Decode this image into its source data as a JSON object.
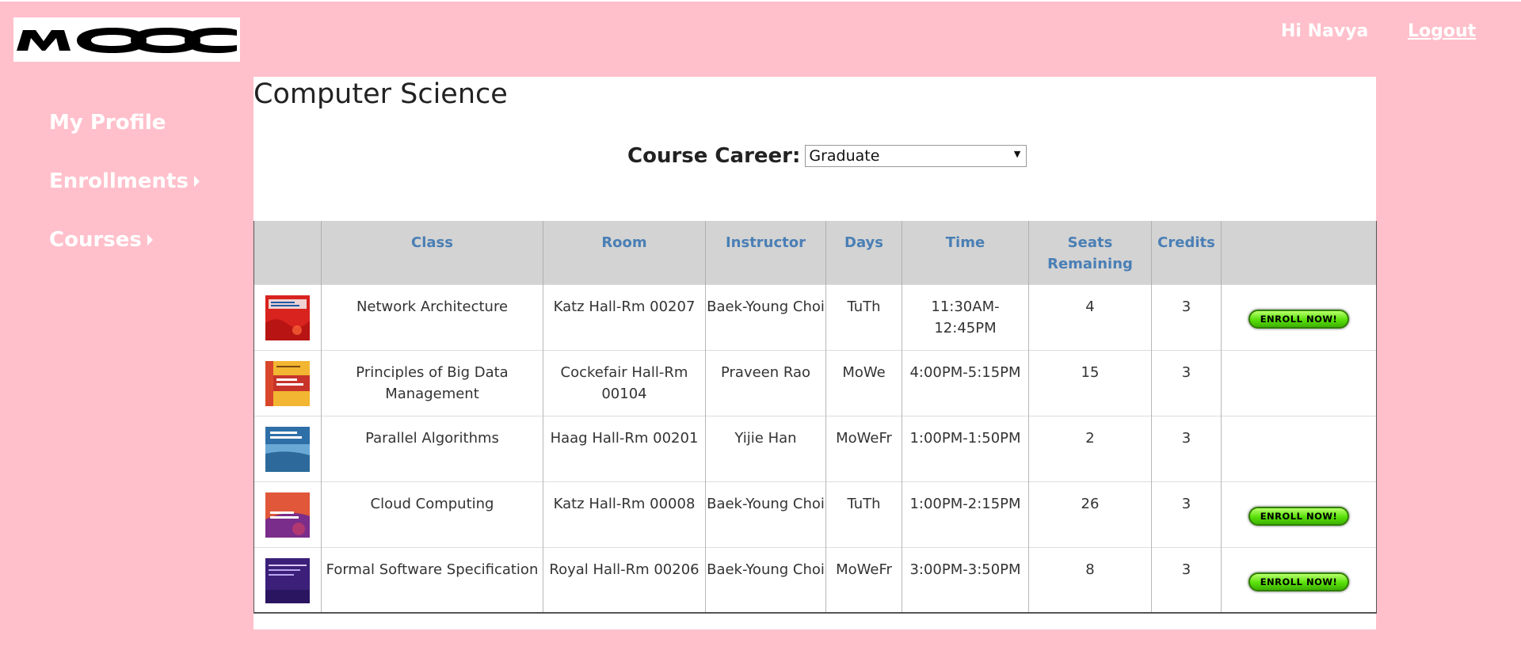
{
  "header": {
    "logo_text": "MOOC",
    "greeting": "Hi Navya",
    "logout_label": "Logout"
  },
  "sidebar": {
    "items": [
      {
        "label": "My Profile",
        "has_submenu": false
      },
      {
        "label": "Enrollments",
        "has_submenu": true
      },
      {
        "label": "Courses",
        "has_submenu": true
      }
    ]
  },
  "main": {
    "title": "Computer Science",
    "career_label": "Course Career:",
    "career_selected": "Graduate"
  },
  "table": {
    "headers": [
      "",
      "Class",
      "Room",
      "Instructor",
      "Days",
      "Time",
      "Seats Remaining",
      "Credits",
      ""
    ],
    "rows": [
      {
        "class": "Network Architecture",
        "room": "Katz Hall-Rm 00207",
        "instructor": "Baek-Young Choi",
        "days": "TuTh",
        "time": "11:30AM-12:45PM",
        "seats": "4",
        "credits": "3",
        "enroll": "ENROLL NOW!",
        "cover": "network-architecture-book-cover-icon"
      },
      {
        "class": "Principles of Big Data Management",
        "room": "Cockefair Hall-Rm 00104",
        "instructor": "Praveen Rao",
        "days": "MoWe",
        "time": "4:00PM-5:15PM",
        "seats": "15",
        "credits": "3",
        "enroll": "",
        "cover": "big-data-book-cover-icon"
      },
      {
        "class": "Parallel Algorithms",
        "room": "Haag Hall-Rm 00201",
        "instructor": "Yijie Han",
        "days": "MoWeFr",
        "time": "1:00PM-1:50PM",
        "seats": "2",
        "credits": "3",
        "enroll": "",
        "cover": "parallel-algorithms-book-cover-icon"
      },
      {
        "class": "Cloud Computing",
        "room": "Katz Hall-Rm 00008",
        "instructor": "Baek-Young Choi",
        "days": "TuTh",
        "time": "1:00PM-2:15PM",
        "seats": "26",
        "credits": "3",
        "enroll": "ENROLL NOW!",
        "cover": "cloud-computing-book-cover-icon"
      },
      {
        "class": "Formal Software Specification",
        "room": "Royal Hall-Rm 00206",
        "instructor": "Baek-Young Choi",
        "days": "MoWeFr",
        "time": "3:00PM-3:50PM",
        "seats": "8",
        "credits": "3",
        "enroll": "ENROLL NOW!",
        "cover": "formal-software-book-cover-icon"
      }
    ]
  },
  "colors": {
    "background": "#ffc0cb",
    "panel": "#ffffff",
    "header_bg": "#d3d3d3",
    "header_text": "#4a7fb5",
    "enroll_green": "#58e00a"
  }
}
